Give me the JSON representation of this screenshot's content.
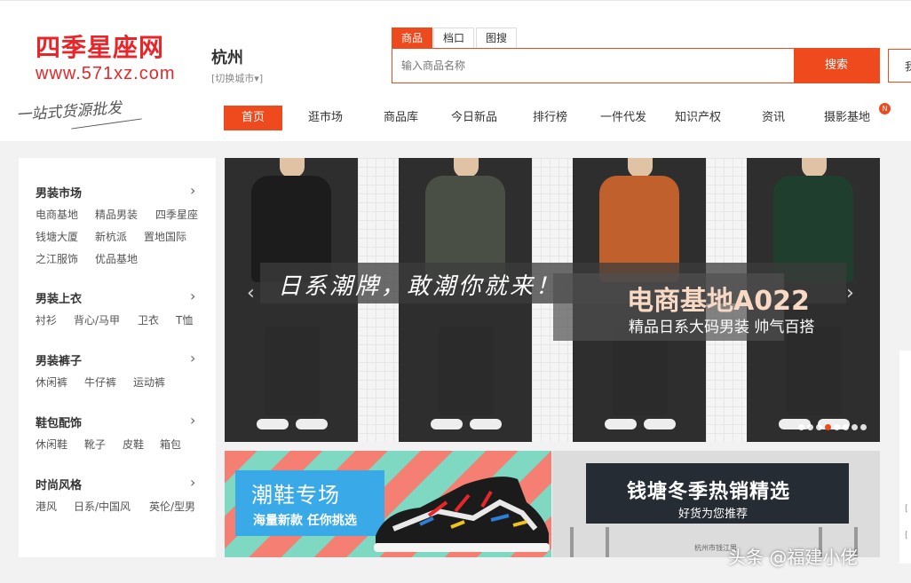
{
  "logo": {
    "main": "四季星座网",
    "url": "www.571xz.com",
    "slogan": "一站式货源批发"
  },
  "city": {
    "name": "杭州",
    "switch_label": "[切换城市▾]"
  },
  "search": {
    "tabs": [
      "商品",
      "档口",
      "图搜"
    ],
    "active_tab": 0,
    "placeholder": "输入商品名称",
    "button_label": "搜索",
    "extra_label": "我"
  },
  "nav": {
    "items": [
      "首页",
      "逛市场",
      "商品库",
      "今日新品",
      "排行榜",
      "一件代发",
      "知识产权",
      "资讯",
      "摄影基地"
    ],
    "active": 0,
    "badge": "N"
  },
  "sidebar": {
    "categories": [
      {
        "title": "男装市场",
        "links": [
          "电商基地",
          "精品男装",
          "四季星座",
          "钱塘大厦",
          "新杭派",
          "置地国际",
          "之江服饰",
          "优品基地"
        ]
      },
      {
        "title": "男装上衣",
        "links": [
          "衬衫",
          "背心/马甲",
          "卫衣",
          "T恤"
        ]
      },
      {
        "title": "男装裤子",
        "links": [
          "休闲裤",
          "牛仔裤",
          "运动裤"
        ]
      },
      {
        "title": "鞋包配饰",
        "links": [
          "休闲鞋",
          "靴子",
          "皮鞋",
          "箱包"
        ]
      },
      {
        "title": "时尚风格",
        "links": [
          "港风",
          "日系/中国风",
          "英伦/型男"
        ]
      }
    ],
    "arrow": "›"
  },
  "banner": {
    "slogan": "日系潮牌，敢潮你就来！",
    "promo_title": "电商基地A022",
    "promo_sub": "精品日系大码男装 帅气百搭",
    "shirt_colors": [
      "#1c1c1c",
      "#4a4f46",
      "#c0602c",
      "#1f3e2e"
    ],
    "slide_count": 8,
    "active_slide": 3,
    "accent": "#ee4a1e"
  },
  "promos": {
    "left": {
      "title": "潮鞋专场",
      "sub": "海量新款 任你挑选"
    },
    "right": {
      "title": "钱塘冬季热销精选",
      "sub": "好货为您推荐",
      "caption": "杭州市钱江男"
    }
  },
  "watermark": "头条 @福建小佬"
}
